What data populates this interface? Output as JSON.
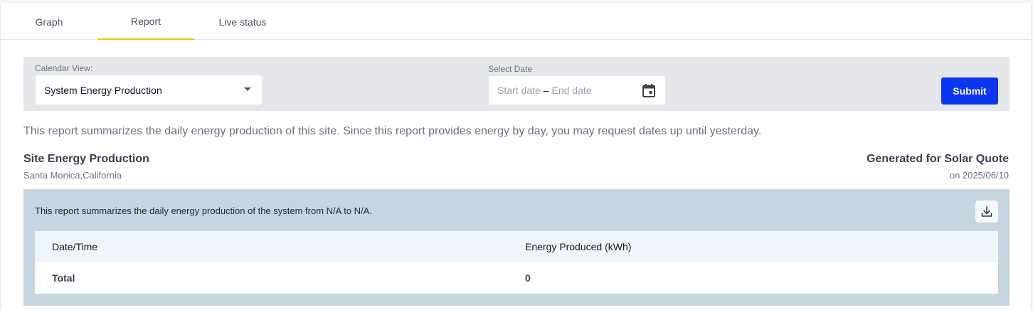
{
  "tabs": [
    {
      "label": "Graph",
      "active": false
    },
    {
      "label": "Report",
      "active": true
    },
    {
      "label": "Live status",
      "active": false
    }
  ],
  "filters": {
    "calendar_view_label": "Calendar View:",
    "calendar_view_value": "System Energy Production",
    "select_date_label": "Select Date",
    "start_placeholder": "Start date",
    "range_separator": "–",
    "end_placeholder": "End date",
    "submit_label": "Submit"
  },
  "intro_text": "This report summarizes the daily energy production of this site. Since this report provides energy by day, you may request dates up until yesterday.",
  "site": {
    "title": "Site Energy Production",
    "location": "Santa Monica,California"
  },
  "generated": {
    "title": "Generated for Solar Quote",
    "date": "on 2025/06/10"
  },
  "report": {
    "summary": "This report summarizes the daily energy production of the system from N/A to N/A.",
    "columns": [
      "Date/Time",
      "Energy Produced (kWh)"
    ],
    "total_label": "Total",
    "total_value": "0"
  },
  "colors": {
    "accent": "#0a36f0",
    "tab_underline": "#f0c419",
    "report_bg": "#c5d6e0",
    "filter_bg": "#e5e7eb"
  },
  "icons": {
    "calendar": "calendar-icon",
    "download": "download-icon",
    "dropdown": "chevron-down-icon"
  }
}
